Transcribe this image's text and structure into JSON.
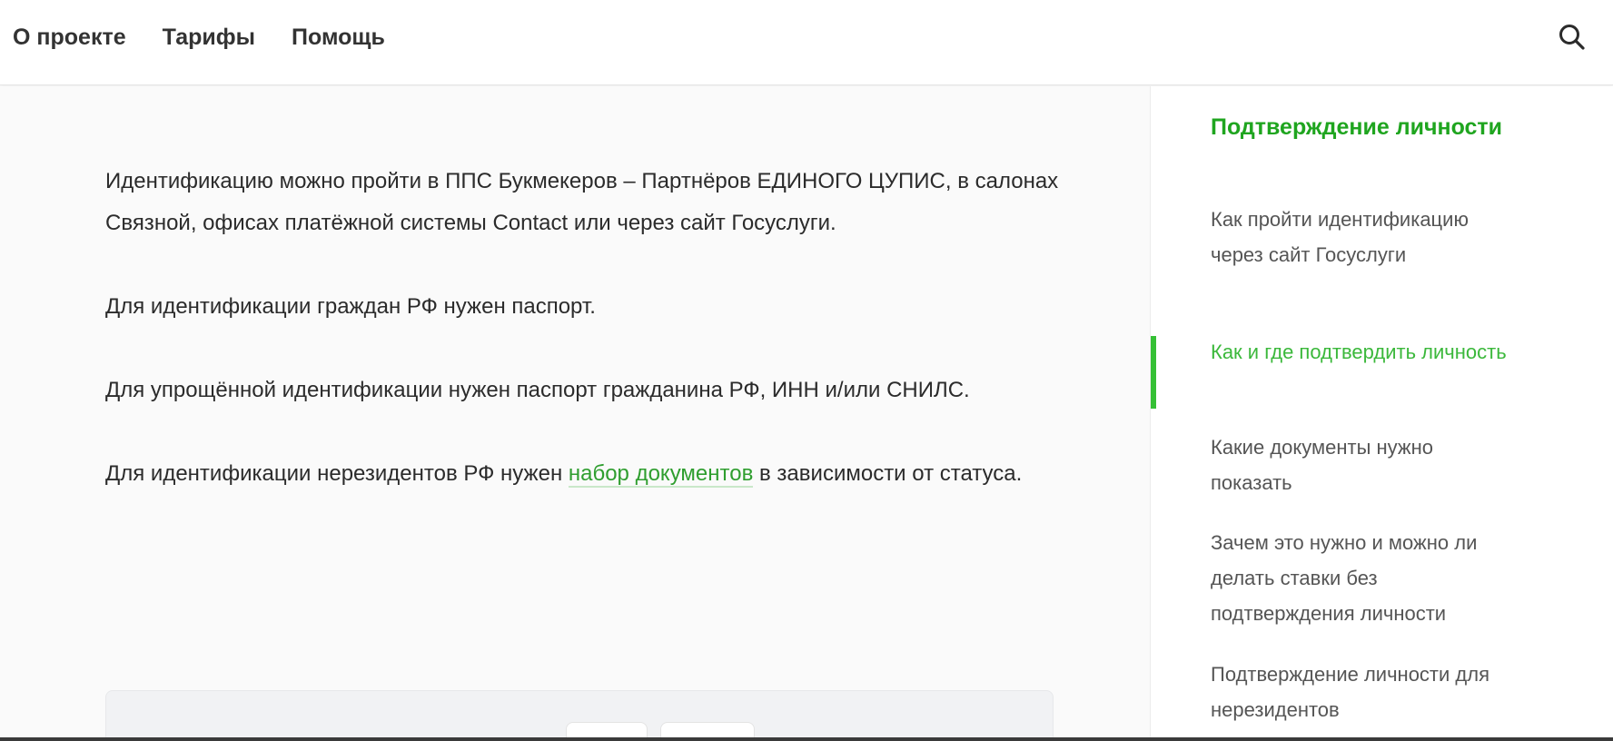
{
  "nav": {
    "items": [
      {
        "label": "О проекте"
      },
      {
        "label": "Тарифы"
      },
      {
        "label": "Помощь"
      }
    ],
    "search_icon": "search-icon"
  },
  "content": {
    "paragraphs": [
      "Идентификацию можно пройти в ППС Букмекеров – Партнёров ЕДИНОГО ЦУПИС, в салонах Связной, офисах платёжной системы Contact или через сайт Госуслуги.",
      "Для идентификации граждан РФ нужен паспорт.",
      "Для упрощённой идентификации нужен паспорт гражданина РФ, ИНН и/или СНИЛС."
    ],
    "last_paragraph": {
      "before": "Для идентификации нерезидентов РФ нужен ",
      "link": "набор документов",
      "after": " в зависимости от статуса."
    }
  },
  "sidebar": {
    "title": "Подтверждение личности",
    "items": [
      {
        "label": "Как пройти идентификацию через сайт Госуслуги",
        "active": false
      },
      {
        "label": "Как и где подтвердить личность",
        "active": true
      },
      {
        "label": "Какие документы нужно показать",
        "active": false
      },
      {
        "label": "Зачем это нужно и можно ли делать ставки без подтверждения личности",
        "active": false
      },
      {
        "label": "Подтверждение личности для нерезидентов",
        "active": false
      }
    ]
  },
  "colors": {
    "accent": "#1fa51f",
    "active_link": "#3bb83b",
    "link": "#2f9e2f",
    "text": "#2b2b2b"
  }
}
